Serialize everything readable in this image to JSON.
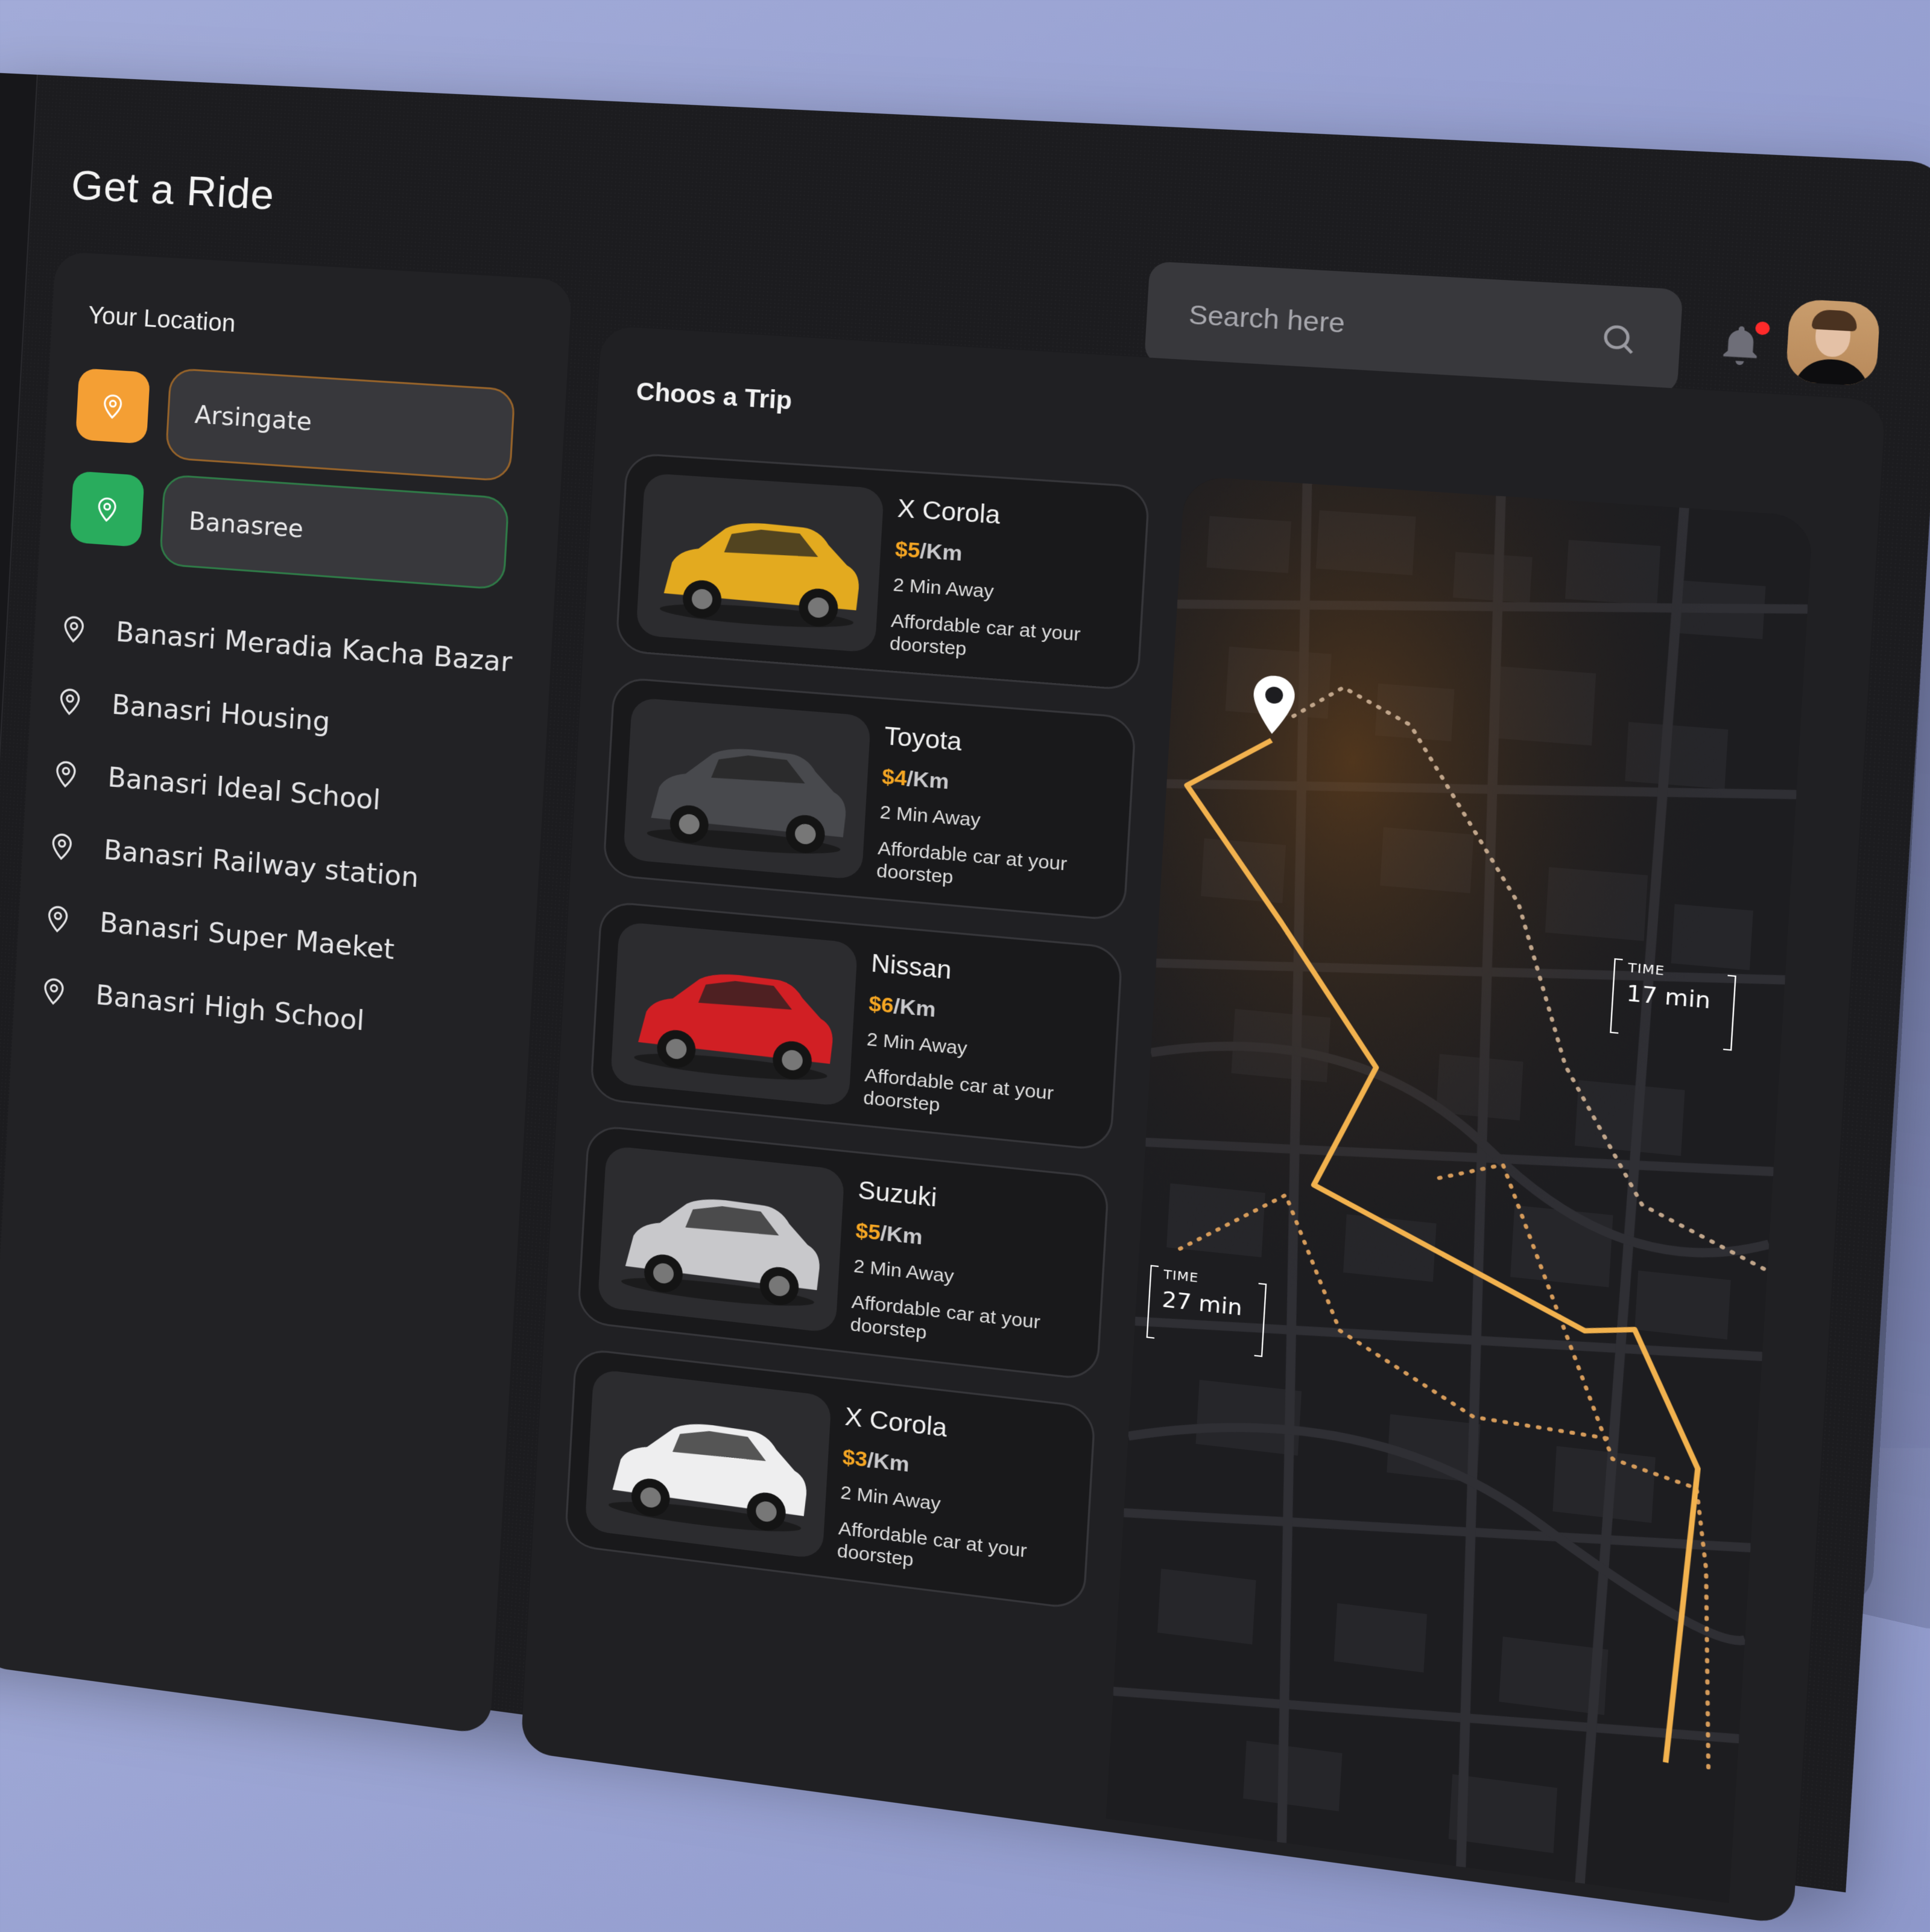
{
  "header": {
    "title": "Get a Ride",
    "search_placeholder": "Search here",
    "notification_badge_color": "#ff2a2a"
  },
  "location": {
    "title": "Your Location",
    "from": {
      "value": "Arsingate",
      "accent": "#f49f34"
    },
    "to": {
      "value": "Banasree",
      "accent": "#29ac5d"
    },
    "suggestions": [
      "Banasri Meradia Kacha Bazar",
      "Banasri Housing",
      "Banasri  Ideal School",
      "Banasri Railway station",
      "Banasri  Super Maeket",
      "Banasri High School"
    ]
  },
  "trips": {
    "title": "Choos a Trip",
    "price_accent": "#f5a623",
    "items": [
      {
        "name": "X Corola",
        "price": "$5",
        "unit": "/Km",
        "eta": "2 Min Away",
        "desc": "Affordable car at your doorstep",
        "car_color": "#e3aa1f"
      },
      {
        "name": "Toyota",
        "price": "$4",
        "unit": "/Km",
        "eta": "2 Min Away",
        "desc": "Affordable car at your doorstep",
        "car_color": "#48494d"
      },
      {
        "name": "Nissan",
        "price": "$6",
        "unit": "/Km",
        "eta": "2 Min Away",
        "desc": "Affordable car at your doorstep",
        "car_color": "#d11f24"
      },
      {
        "name": "Suzuki",
        "price": "$5",
        "unit": "/Km",
        "eta": "2 Min Away",
        "desc": "Affordable car at your doorstep",
        "car_color": "#c8c8cb"
      },
      {
        "name": "X Corola",
        "price": "$3",
        "unit": "/Km",
        "eta": "2 Min Away",
        "desc": "Affordable car at your doorstep",
        "car_color": "#eeeeef"
      }
    ]
  },
  "map": {
    "route_color": "#f2b24e",
    "labels": [
      {
        "title": "TIME",
        "value": "17 min"
      },
      {
        "title": "TIME",
        "value": "27 min"
      }
    ]
  }
}
